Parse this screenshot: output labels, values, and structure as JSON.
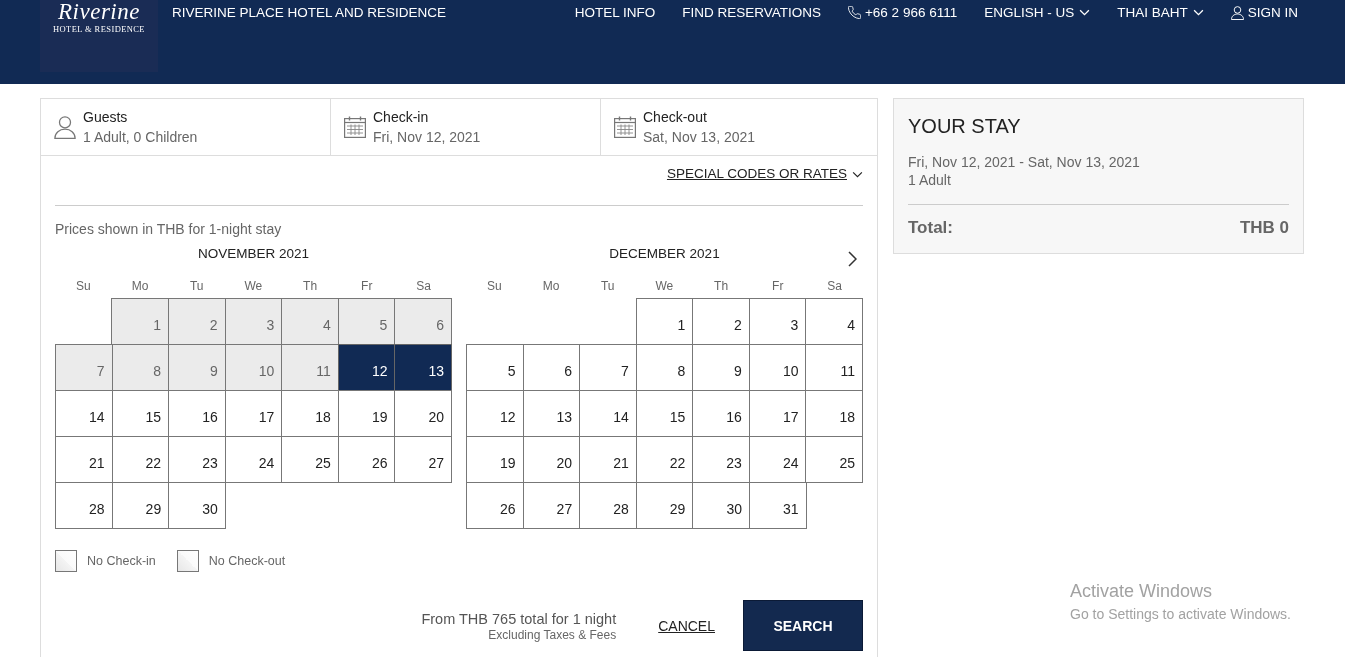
{
  "header": {
    "logo": {
      "script": "Riverine",
      "tagline": "HOTEL & RESIDENCE"
    },
    "title": "RIVERINE PLACE HOTEL AND RESIDENCE",
    "nav": [
      {
        "kind": "link",
        "label": "HOTEL INFO"
      },
      {
        "kind": "link",
        "label": "FIND RESERVATIONS"
      },
      {
        "kind": "phone",
        "label": "+66 2 966 6111"
      },
      {
        "kind": "dropdown",
        "label": "ENGLISH - US"
      },
      {
        "kind": "dropdown",
        "label": "THAI BAHT"
      },
      {
        "kind": "account",
        "label": "SIGN IN"
      }
    ]
  },
  "search_bar": [
    {
      "kind": "guests",
      "label": "Guests",
      "value": "1 Adult, 0 Children"
    },
    {
      "kind": "date",
      "label": "Check-in",
      "value": "Fri, Nov 12, 2021"
    },
    {
      "kind": "date",
      "label": "Check-out",
      "value": "Sat, Nov 13, 2021"
    }
  ],
  "special_codes": "SPECIAL CODES OR RATES",
  "price_note": "Prices shown in THB for 1-night stay",
  "months": [
    {
      "title": "NOVEMBER 2021",
      "weekdays": [
        "Su",
        "Mo",
        "Tu",
        "We",
        "Th",
        "Fr",
        "Sa"
      ],
      "weeks": [
        [
          {
            "day": "1",
            "disabled": true,
            "selected": false
          },
          {
            "day": "2",
            "disabled": true,
            "selected": false
          },
          {
            "day": "3",
            "disabled": true,
            "selected": false
          },
          {
            "day": "4",
            "disabled": true,
            "selected": false
          },
          {
            "day": "5",
            "disabled": true,
            "selected": false
          },
          {
            "day": "6",
            "disabled": true,
            "selected": false
          }
        ],
        [
          {
            "day": "7",
            "disabled": true,
            "selected": false
          },
          {
            "day": "8",
            "disabled": true,
            "selected": false
          },
          {
            "day": "9",
            "disabled": true,
            "selected": false
          },
          {
            "day": "10",
            "disabled": true,
            "selected": false
          },
          {
            "day": "11",
            "disabled": true,
            "selected": false
          },
          {
            "day": "12",
            "disabled": false,
            "selected": true
          },
          {
            "day": "13",
            "disabled": false,
            "selected": true
          }
        ],
        [
          {
            "day": "14",
            "disabled": false,
            "selected": false
          },
          {
            "day": "15",
            "disabled": false,
            "selected": false
          },
          {
            "day": "16",
            "disabled": false,
            "selected": false
          },
          {
            "day": "17",
            "disabled": false,
            "selected": false
          },
          {
            "day": "18",
            "disabled": false,
            "selected": false
          },
          {
            "day": "19",
            "disabled": false,
            "selected": false
          },
          {
            "day": "20",
            "disabled": false,
            "selected": false
          }
        ],
        [
          {
            "day": "21",
            "disabled": false,
            "selected": false
          },
          {
            "day": "22",
            "disabled": false,
            "selected": false
          },
          {
            "day": "23",
            "disabled": false,
            "selected": false
          },
          {
            "day": "24",
            "disabled": false,
            "selected": false
          },
          {
            "day": "25",
            "disabled": false,
            "selected": false
          },
          {
            "day": "26",
            "disabled": false,
            "selected": false
          },
          {
            "day": "27",
            "disabled": false,
            "selected": false
          }
        ],
        [
          {
            "day": "28",
            "disabled": false,
            "selected": false
          },
          {
            "day": "29",
            "disabled": false,
            "selected": false
          },
          {
            "day": "30",
            "disabled": false,
            "selected": false
          }
        ]
      ]
    },
    {
      "title": "DECEMBER 2021",
      "weekdays": [
        "Su",
        "Mo",
        "Tu",
        "We",
        "Th",
        "Fr",
        "Sa"
      ],
      "weeks": [
        [
          {
            "day": "1",
            "disabled": false,
            "selected": false
          },
          {
            "day": "2",
            "disabled": false,
            "selected": false
          },
          {
            "day": "3",
            "disabled": false,
            "selected": false
          },
          {
            "day": "4",
            "disabled": false,
            "selected": false
          }
        ],
        [
          {
            "day": "5",
            "disabled": false,
            "selected": false
          },
          {
            "day": "6",
            "disabled": false,
            "selected": false
          },
          {
            "day": "7",
            "disabled": false,
            "selected": false
          },
          {
            "day": "8",
            "disabled": false,
            "selected": false
          },
          {
            "day": "9",
            "disabled": false,
            "selected": false
          },
          {
            "day": "10",
            "disabled": false,
            "selected": false
          },
          {
            "day": "11",
            "disabled": false,
            "selected": false
          }
        ],
        [
          {
            "day": "12",
            "disabled": false,
            "selected": false
          },
          {
            "day": "13",
            "disabled": false,
            "selected": false
          },
          {
            "day": "14",
            "disabled": false,
            "selected": false
          },
          {
            "day": "15",
            "disabled": false,
            "selected": false
          },
          {
            "day": "16",
            "disabled": false,
            "selected": false
          },
          {
            "day": "17",
            "disabled": false,
            "selected": false
          },
          {
            "day": "18",
            "disabled": false,
            "selected": false
          }
        ],
        [
          {
            "day": "19",
            "disabled": false,
            "selected": false
          },
          {
            "day": "20",
            "disabled": false,
            "selected": false
          },
          {
            "day": "21",
            "disabled": false,
            "selected": false
          },
          {
            "day": "22",
            "disabled": false,
            "selected": false
          },
          {
            "day": "23",
            "disabled": false,
            "selected": false
          },
          {
            "day": "24",
            "disabled": false,
            "selected": false
          },
          {
            "day": "25",
            "disabled": false,
            "selected": false
          }
        ],
        [
          {
            "day": "26",
            "disabled": false,
            "selected": false
          },
          {
            "day": "27",
            "disabled": false,
            "selected": false
          },
          {
            "day": "28",
            "disabled": false,
            "selected": false
          },
          {
            "day": "29",
            "disabled": false,
            "selected": false
          },
          {
            "day": "30",
            "disabled": false,
            "selected": false
          },
          {
            "day": "31",
            "disabled": false,
            "selected": false
          }
        ]
      ]
    }
  ],
  "legend": [
    {
      "label": "No Check-in"
    },
    {
      "label": "No Check-out"
    }
  ],
  "footer": {
    "price": "From THB 765 total for 1 night",
    "note": "Excluding Taxes & Fees",
    "cancel": "CANCEL",
    "search": "SEARCH"
  },
  "your_stay": {
    "title": "YOUR STAY",
    "dates": "Fri, Nov 12, 2021 - Sat, Nov 13, 2021",
    "guests": "1 Adult",
    "total_label": "Total:",
    "total_value": "THB 0"
  },
  "os_overlay": {
    "title": "Activate Windows",
    "message": "Go to Settings to activate Windows."
  }
}
